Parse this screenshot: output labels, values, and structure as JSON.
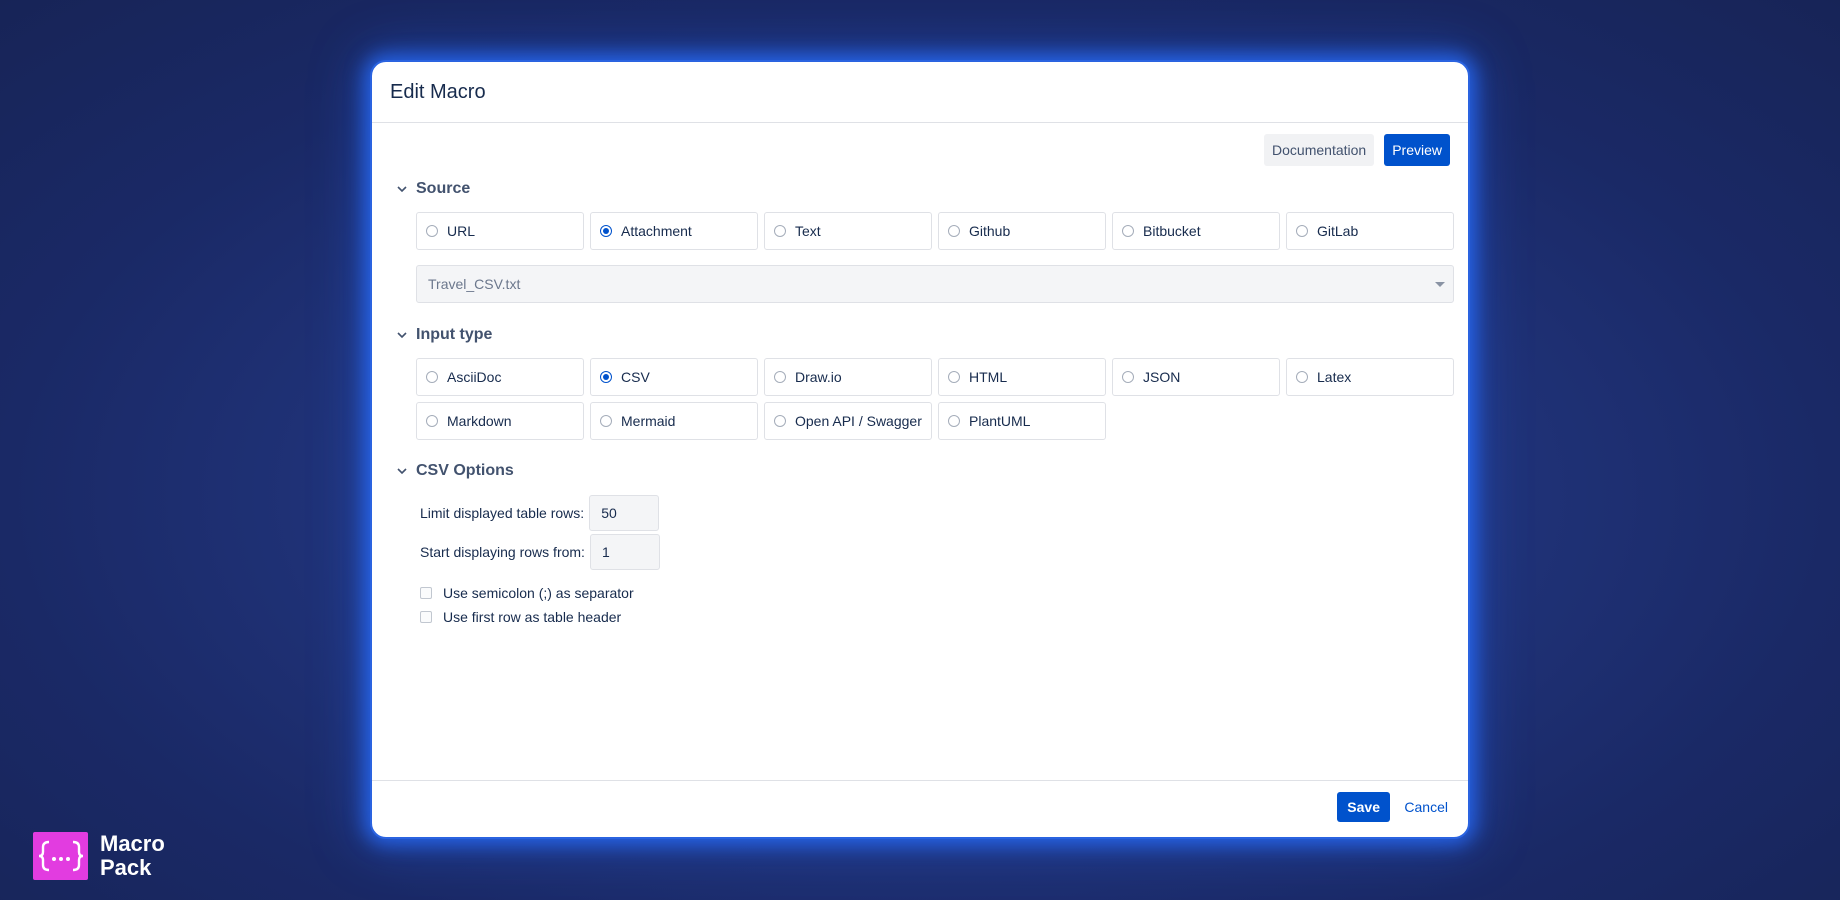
{
  "dialog": {
    "title": "Edit Macro",
    "documentation_label": "Documentation",
    "preview_label": "Preview",
    "save_label": "Save",
    "cancel_label": "Cancel"
  },
  "source": {
    "heading": "Source",
    "options": [
      "URL",
      "Attachment",
      "Text",
      "Github",
      "Bitbucket",
      "GitLab"
    ],
    "selected": "Attachment",
    "attachment_value": "Travel_CSV.txt"
  },
  "input_type": {
    "heading": "Input type",
    "options": [
      "AsciiDoc",
      "CSV",
      "Draw.io",
      "HTML",
      "JSON",
      "Latex",
      "Markdown",
      "Mermaid",
      "Open API / Swagger",
      "PlantUML"
    ],
    "selected": "CSV"
  },
  "csv_options": {
    "heading": "CSV Options",
    "limit_label": "Limit displayed table rows:",
    "limit_value": "50",
    "start_label": "Start displaying rows from:",
    "start_value": "1",
    "semicolon_label": "Use semicolon (;) as separator",
    "semicolon_checked": false,
    "header_label": "Use first row as table header",
    "header_checked": false
  },
  "brand": {
    "line1": "Macro",
    "line2": "Pack",
    "logo_glyph": "{...}",
    "logo_color": "#e23ce0"
  },
  "colors": {
    "accent": "#0052cc",
    "dialog_border": "#2a63e0"
  }
}
